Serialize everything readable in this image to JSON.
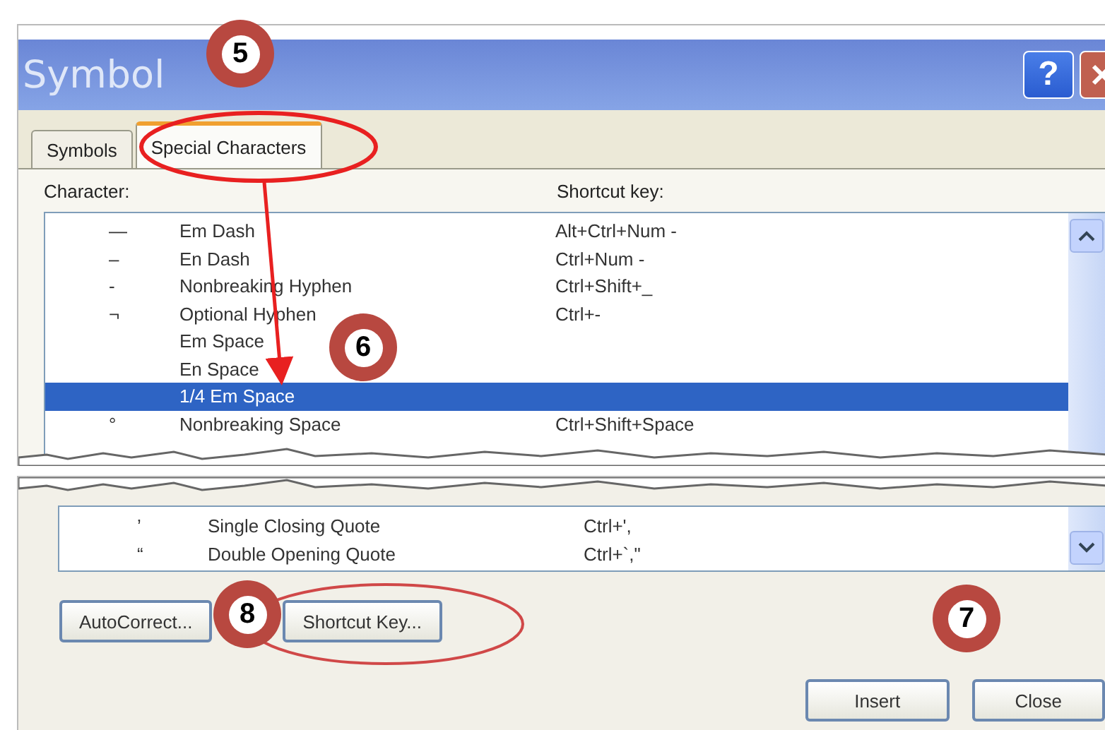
{
  "window": {
    "title": "Symbol",
    "help_label": "?"
  },
  "tabs": [
    {
      "label": "Symbols",
      "selected": false
    },
    {
      "label": "Special Characters",
      "selected": true
    }
  ],
  "columns": [
    "Character:",
    "Shortcut key:"
  ],
  "rows": [
    {
      "symbol": "—",
      "name": "Em Dash",
      "shortcut": "Alt+Ctrl+Num -",
      "selected": false
    },
    {
      "symbol": "–",
      "name": "En Dash",
      "shortcut": "Ctrl+Num -",
      "selected": false
    },
    {
      "symbol": "-",
      "name": "Nonbreaking Hyphen",
      "shortcut": "Ctrl+Shift+_",
      "selected": false
    },
    {
      "symbol": "¬",
      "name": "Optional Hyphen",
      "shortcut": "Ctrl+-",
      "selected": false
    },
    {
      "name": "Em Space",
      "selected": false
    },
    {
      "name": "En Space",
      "selected": false
    },
    {
      "name": "1/4 Em Space",
      "selected": true
    },
    {
      "symbol": "°",
      "name": "Nonbreaking Space",
      "shortcut": "Ctrl+Shift+Space",
      "selected": false
    }
  ],
  "lower_rows": [
    {
      "symbol": "’",
      "name": "Single Closing Quote",
      "shortcut": "Ctrl+',",
      "selected": false
    },
    {
      "symbol": "“",
      "name": "Double Opening Quote",
      "shortcut": "Ctrl+`,\"",
      "selected": false
    }
  ],
  "option_buttons": [
    "AutoCorrect...",
    "Shortcut Key..."
  ],
  "dialog_buttons": [
    "Insert",
    "Close"
  ],
  "callouts": [
    {
      "label": "5"
    },
    {
      "label": "6"
    },
    {
      "label": "7"
    },
    {
      "label": "8"
    }
  ]
}
